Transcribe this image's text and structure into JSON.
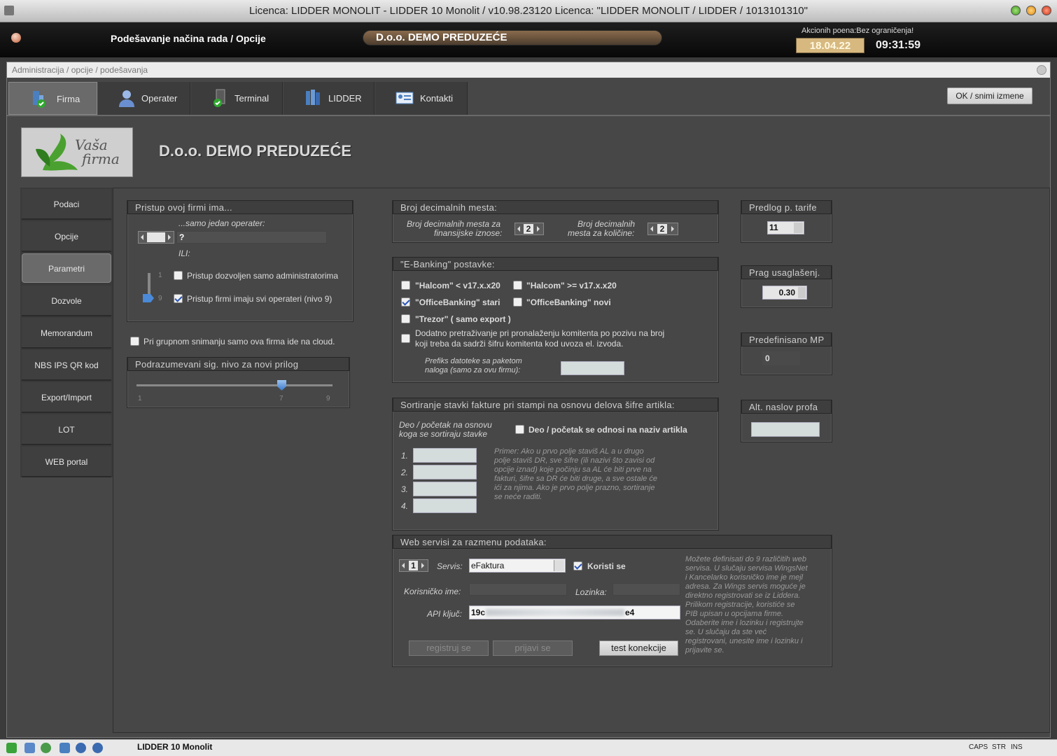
{
  "window": {
    "title": "Licenca: LIDDER MONOLIT - LIDDER 10 Monolit / v10.98.23120 Licenca: \"LIDDER MONOLIT / LIDDER / 1013101310\""
  },
  "header": {
    "title": "Podešavanje načina rada / Opcije",
    "company": "D.o.o. DEMO PREDUZEĆE",
    "promo": "Akcionih poena:Bez ograničenja!",
    "date": "18.04.22",
    "time": "09:31:59"
  },
  "breadcrumb": "Administracija / opcije / podešavanja",
  "tabs": [
    {
      "label": "Firma",
      "icon": "firma-icon"
    },
    {
      "label": "Operater",
      "icon": "operater-icon"
    },
    {
      "label": "Terminal",
      "icon": "terminal-icon"
    },
    {
      "label": "LIDDER",
      "icon": "lidder-icon"
    },
    {
      "label": "Kontakti",
      "icon": "kontakti-icon"
    }
  ],
  "ok_button": "OK / snimi izmene",
  "logo": {
    "line1": "Vaša",
    "line2": "firma"
  },
  "company_name": "D.o.o. DEMO PREDUZEĆE",
  "sidebar": [
    {
      "label": "Podaci"
    },
    {
      "label": "Opcije"
    },
    {
      "label": "Parametri",
      "active": true
    },
    {
      "label": "Dozvole"
    },
    {
      "label": "Memorandum"
    },
    {
      "label": "NBS IPS QR kod"
    },
    {
      "label": "Export/Import"
    },
    {
      "label": "LOT"
    },
    {
      "label": "WEB portal"
    }
  ],
  "pristup": {
    "title": "Pristup ovoj firmi ima...",
    "single_operator": "...samo jedan operater:",
    "operator_value": "?",
    "ili": "ILI:",
    "slider_top": "1",
    "slider_bottom": "9",
    "admin_only": "Pristup dozvoljen samo administratorima",
    "all_operators": "Pristup firmi imaju svi operateri (nivo 9)",
    "admin_only_checked": false,
    "all_operators_checked": true
  },
  "cloud": {
    "label": "Pri grupnom snimanju samo ova firma ide na cloud.",
    "checked": false
  },
  "sig_nivo": {
    "title": "Podrazumevani sig. nivo za novi prilog",
    "min": "1",
    "value": "7",
    "max": "9",
    "level": 7
  },
  "decimals": {
    "title": "Broj decimalnih mesta:",
    "fin_label_1": "Broj decimalnih mesta za",
    "fin_label_2": "finansijske iznose:",
    "fin_value": "2",
    "qty_label_1": "Broj decimalnih",
    "qty_label_2": "mesta za količine:",
    "qty_value": "2"
  },
  "ebanking": {
    "title": "\"E-Banking\" postavke:",
    "halcom_old": "\"Halcom\" < v17.x.x20",
    "halcom_new": "\"Halcom\" >= v17.x.x20",
    "ob_old": "\"OfficeBanking\" stari",
    "ob_new": "\"OfficeBanking\" novi",
    "trezor": "\"Trezor\" ( samo export )",
    "search_line1": "Dodatno pretraživanje pri pronalaženju komitenta po pozivu na broj",
    "search_line2": "koji treba da sadrži šifru komitenta kod uvoza el. izvoda.",
    "prefix_line1": "Prefiks datoteke sa paketom",
    "prefix_line2": "naloga (samo za ovu firmu):",
    "ob_old_checked": true
  },
  "sort": {
    "title": "Sortiranje stavki fakture pri stampi na osnovu delova šifre artikla:",
    "part_line1": "Deo / početak na osnovu",
    "part_line2": "koga se sortiraju stavke",
    "name_check": "Deo / početak se odnosi na naziv artikla",
    "rows": [
      "1.",
      "2.",
      "3.",
      "4."
    ],
    "note": [
      "Primer: Ako u prvo polje staviš AL a u drugo",
      "polje staviš DR, sve šifre (ili nazivi što zavisi od",
      "opcije iznad) koje počinju sa AL će biti prve na",
      "fakturi, šifre sa DR će biti druge, a sve ostale će",
      "ići za njima. Ako je prvo polje prazno, sortiranje",
      "se neće raditi."
    ]
  },
  "web": {
    "title": "Web servisi za razmenu podataka:",
    "index": "1",
    "servis_label": "Servis:",
    "servis_value": "eFaktura",
    "use_label": "Koristi se",
    "use_checked": true,
    "user_label": "Korisničko ime:",
    "pass_label": "Lozinka:",
    "api_label": "API ključ:",
    "api_start": "19c",
    "api_end": "e4",
    "register": "registruj se",
    "login": "prijavi se",
    "test": "test konekcije",
    "note": [
      "Možete definisati do 9 različitih web",
      "servisa. U slučaju servisa WingsNet",
      "i Kancelarko korisničko ime je mejl",
      "adresa. Za Wings servis moguće je",
      "direktno registrovati se iz Liddera.",
      "Prilikom registracije, koristiće se",
      "PIB upisan u opcijama firme.",
      "Odaberite ime i lozinku i registrujte",
      "se. U slučaju da ste već",
      "registrovani, unesite ime i lozinku i",
      "prijavite se."
    ]
  },
  "right": {
    "tarife_title": "Predlog p. tarife",
    "tarife_value": "11",
    "prag_title": "Prag usaglašenj.",
    "prag_value": "0.30",
    "predef_title": "Predefinisano MP",
    "predef_value": "0",
    "alt_title": "Alt. naslov profa"
  },
  "statusbar": {
    "app": "LIDDER 10 Monolit",
    "caps": "CAPS",
    "str": "STR",
    "ins": "INS"
  }
}
